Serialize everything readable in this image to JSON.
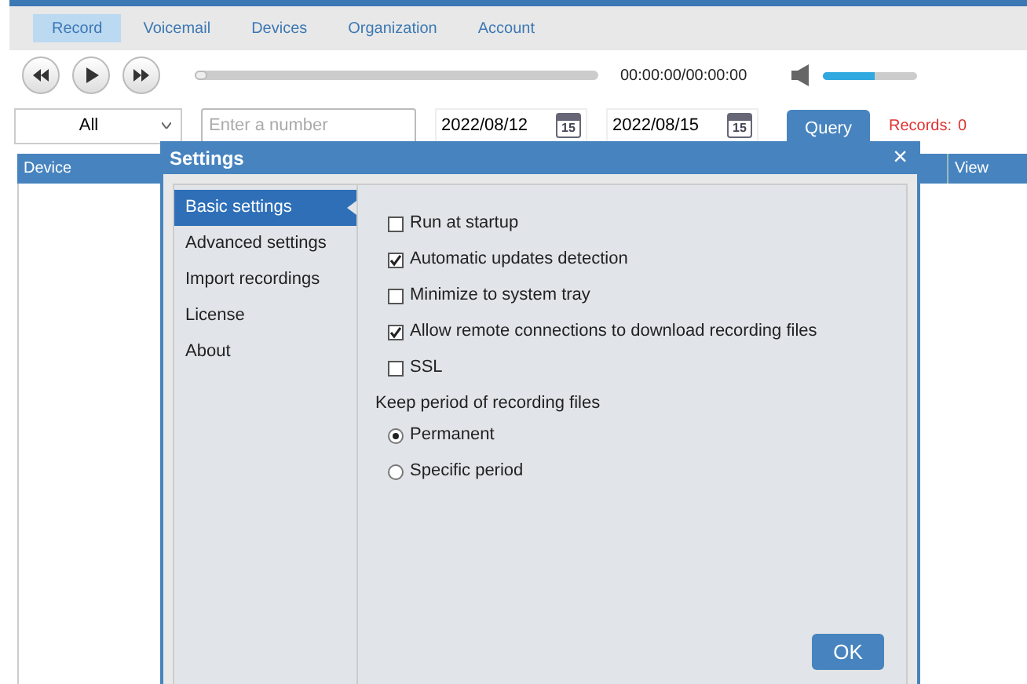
{
  "nav_tabs": [
    {
      "label": "Record",
      "selected": true
    },
    {
      "label": "Voicemail",
      "selected": false
    },
    {
      "label": "Devices",
      "selected": false
    },
    {
      "label": "Organization",
      "selected": false
    },
    {
      "label": "Account",
      "selected": false
    }
  ],
  "player": {
    "progress": {
      "level": 0.03
    },
    "time": "00:00:00/00:00:00",
    "volume": {
      "level": 0.55
    }
  },
  "filter": {
    "type_select": "All",
    "number_field": {
      "placeholder": "Enter a number"
    },
    "date_from": "2022/08/12",
    "date_from_calendar": "15",
    "date_to": "2022/08/15",
    "date_to_calendar": "15",
    "query_button": "Query",
    "records_label": "Records:",
    "records_count": "0"
  },
  "table": {
    "columns": [
      "Device",
      "View"
    ]
  },
  "dialog": {
    "title": "Settings",
    "close": "×",
    "sidebar": [
      {
        "label": "Basic settings",
        "selected": true
      },
      {
        "label": "Advanced settings",
        "selected": false
      },
      {
        "label": "Import recordings",
        "selected": false
      },
      {
        "label": "License",
        "selected": false
      },
      {
        "label": "About",
        "selected": false
      }
    ],
    "options": [
      {
        "label": "Run at startup",
        "checked": false
      },
      {
        "label": "Automatic updates detection",
        "checked": true
      },
      {
        "label": "Minimize to system tray",
        "checked": false
      },
      {
        "label": "Allow remote connections to download recording files",
        "checked": true
      },
      {
        "label": "SSL",
        "checked": false
      }
    ],
    "keep_period": {
      "label": "Keep period of recording files",
      "choices": [
        {
          "label": "Permanent",
          "selected": true
        },
        {
          "label": "Specific period",
          "selected": false
        }
      ]
    },
    "ok_button": "OK"
  }
}
